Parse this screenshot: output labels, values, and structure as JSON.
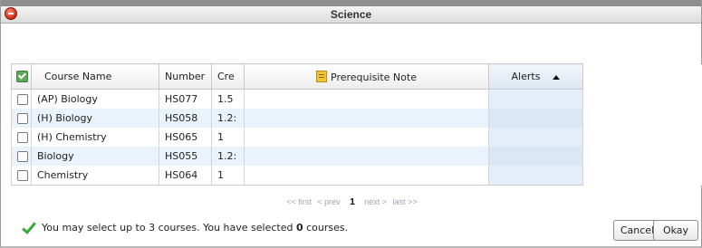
{
  "window": {
    "title": "Science"
  },
  "table": {
    "columns": {
      "course_name": "Course Name",
      "number": "Number",
      "credits": "Cre",
      "prerequisite_note": "Prerequisite Note",
      "alerts": "Alerts"
    },
    "rows": [
      {
        "course_name": "(AP) Biology",
        "number": "HS077",
        "credits": "1.5"
      },
      {
        "course_name": "(H) Biology",
        "number": "HS058",
        "credits": "1.2:"
      },
      {
        "course_name": "(H) Chemistry",
        "number": "HS065",
        "credits": "1"
      },
      {
        "course_name": "Biology",
        "number": "HS055",
        "credits": "1.2:"
      },
      {
        "course_name": "Chemistry",
        "number": "HS064",
        "credits": "1"
      }
    ]
  },
  "pager": {
    "first": "<< first",
    "prev": "< prev",
    "current": "1",
    "next": "next >",
    "last": "last >>"
  },
  "status": {
    "prefix": "You may select up to 3 courses. You have selected ",
    "count": "0",
    "suffix": " courses."
  },
  "buttons": {
    "cancel": "Cancel",
    "okay": "Okay"
  },
  "colors": {
    "row_alt": "#eaf2fb",
    "alerts_col": "#e4eefa",
    "check_green": "#3aa63a",
    "close_red": "#d22a15"
  },
  "icons": {
    "close": "close-icon",
    "select_all": "checkmark-icon",
    "note": "note-icon",
    "sort": "sort-ascending-icon",
    "status": "checkmark-icon"
  }
}
